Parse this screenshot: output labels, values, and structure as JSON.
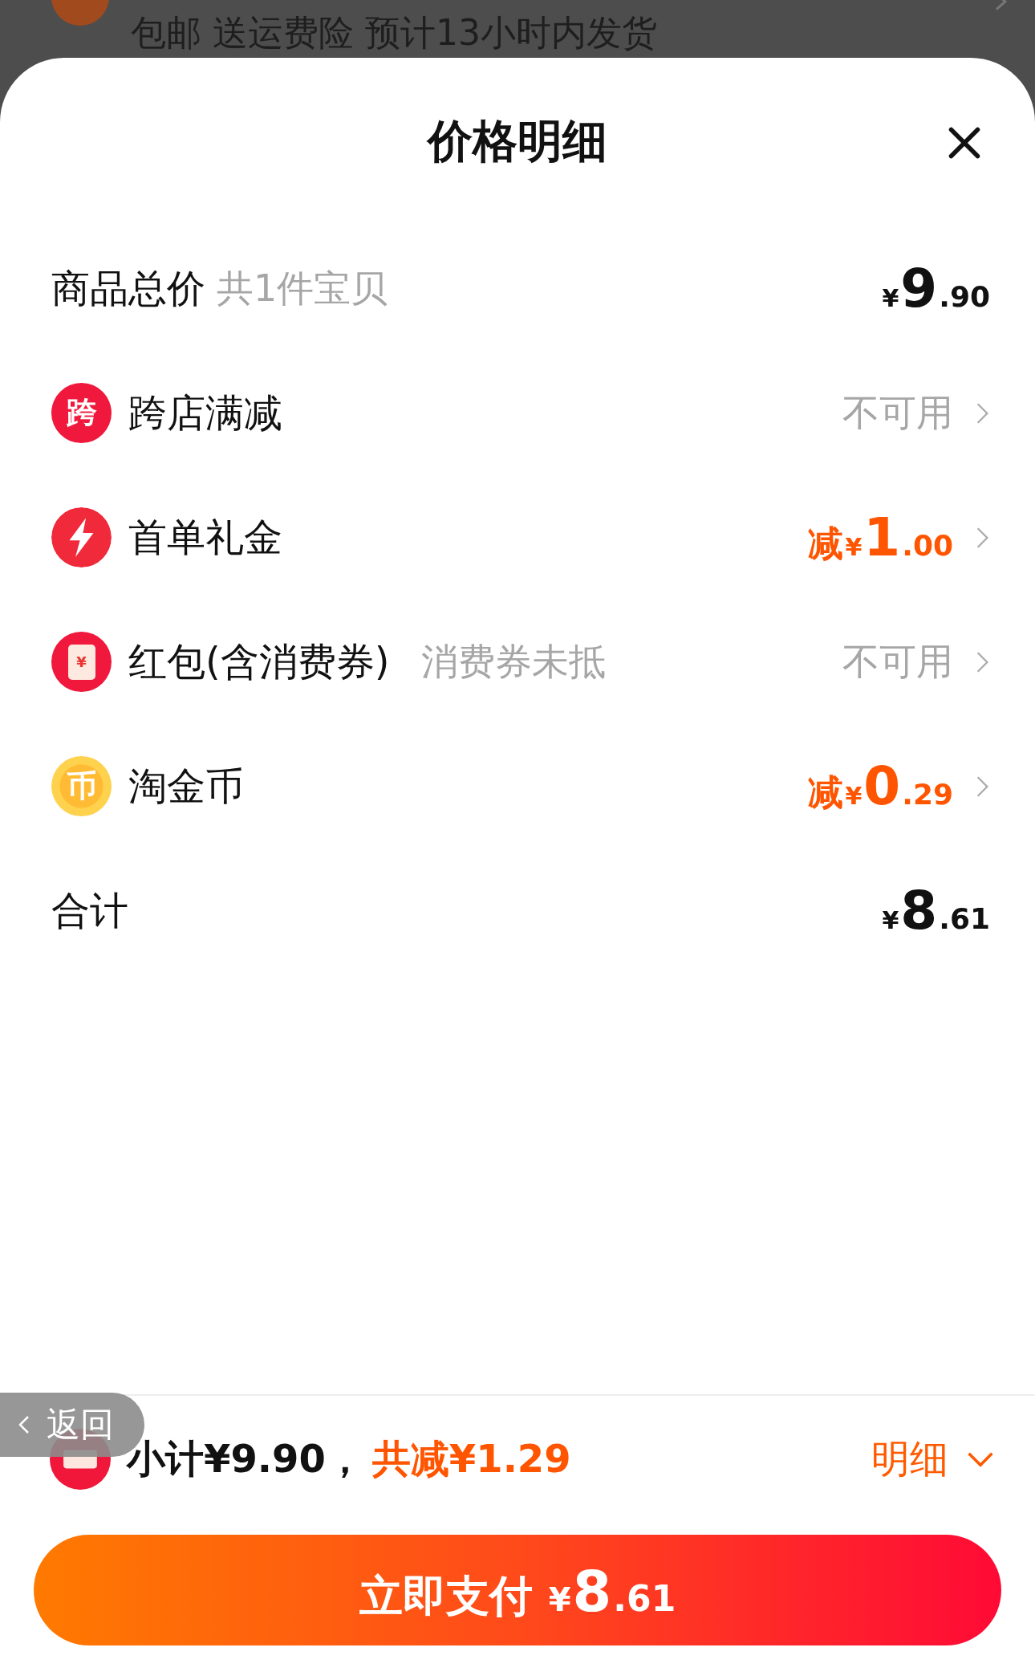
{
  "background": {
    "shipping_note": "包邮 送运费险 预计13小时内发货"
  },
  "sheet": {
    "title": "价格明细"
  },
  "rows": [
    {
      "kind": "total",
      "label": "商品总价",
      "note": "共1件宝贝",
      "amount": {
        "currency": "¥",
        "integer": "9",
        "decimal": ".90",
        "highlight": false
      }
    },
    {
      "kind": "discount",
      "icon": {
        "kind": "char",
        "glyph": "跨"
      },
      "label": "跨店满减",
      "status": "不可用"
    },
    {
      "kind": "discount",
      "icon": {
        "kind": "bolt"
      },
      "label": "首单礼金",
      "amount": {
        "prefix": "减",
        "currency": "¥",
        "integer": "1",
        "decimal": ".00",
        "highlight": true
      }
    },
    {
      "kind": "discount",
      "icon": {
        "kind": "envelope",
        "glyph": "¥"
      },
      "label": "红包(含消费券)",
      "note": "消费券未抵",
      "status": "不可用"
    },
    {
      "kind": "discount",
      "icon": {
        "kind": "coin",
        "glyph": "币"
      },
      "label": "淘金币",
      "amount": {
        "prefix": "减",
        "currency": "¥",
        "integer": "0",
        "decimal": ".29",
        "highlight": true
      }
    },
    {
      "kind": "total",
      "label": "合计",
      "amount": {
        "currency": "¥",
        "integer": "8",
        "decimal": ".61",
        "highlight": false
      }
    }
  ],
  "summary": {
    "subtotal": "小计¥9.90，",
    "saved": "共减¥1.29",
    "details_link": "明细"
  },
  "back_button": {
    "label": "返回"
  },
  "pay_button": {
    "label": "立即支付",
    "currency": "¥",
    "integer": "8",
    "decimal": ".61"
  }
}
